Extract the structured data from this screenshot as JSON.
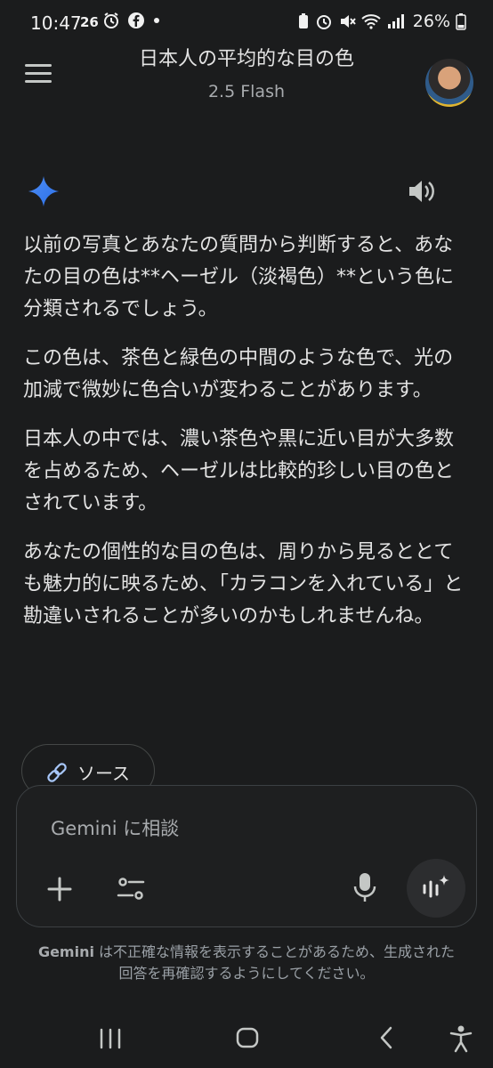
{
  "status_bar": {
    "time": "10:47",
    "notification_count": "26",
    "battery": "26%"
  },
  "header": {
    "title": "日本人の平均的な目の色",
    "model": "2.5 Flash"
  },
  "response": {
    "paragraphs": [
      "以前の写真とあなたの質問から判断すると、あなたの目の色は**ヘーゼル（淡褐色）**という色に分類されるでしょう。",
      "この色は、茶色と緑色の中間のような色で、光の加減で微妙に色合いが変わることがあります。",
      "日本人の中では、濃い茶色や黒に近い目が大多数を占めるため、ヘーゼルは比較的珍しい目の色とされています。",
      "あなたの個性的な目の色は、周りから見るととても魅力的に映るため、「カラコンを入れている」と勘違いされることが多いのかもしれませんね。"
    ]
  },
  "sources": {
    "label": "ソース"
  },
  "composer": {
    "placeholder": "Gemini に相談"
  },
  "disclaimer": {
    "brand": "Gemini",
    "text": " は不正確な情報を表示することがあるため、生成された回答を再確認するようにしてください。"
  },
  "colors": {
    "background": "#1b1c1d",
    "text": "#e3e3e3",
    "muted": "#a8abae",
    "gemini_blue": "#4b8df8",
    "border": "#444746"
  },
  "icons": {
    "menu": "hamburger-menu-icon",
    "gemini": "gemini-sparkle-icon",
    "speaker": "speaker-icon",
    "link": "link-icon",
    "plus": "plus-icon",
    "tools": "tools-sliders-icon",
    "mic": "microphone-icon",
    "live": "gemini-live-icon",
    "nav_recents": "recents-icon",
    "nav_home": "home-icon",
    "nav_back": "back-icon",
    "accessibility": "accessibility-icon"
  }
}
